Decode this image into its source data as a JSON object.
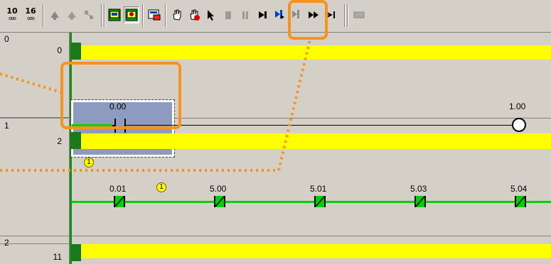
{
  "toolbar": {
    "btn_10": {
      "top": "10",
      "bottom": "ooo"
    },
    "btn_16": {
      "top": "16",
      "bottom": "ooo"
    },
    "icons": [
      "step-in-icon",
      "step-out-icon",
      "network-icon",
      "monitor-window-icon",
      "monitor-mode-icon",
      "program-check-icon",
      "hand-icon",
      "hand-stop-icon",
      "pointer-icon",
      "stop-icon",
      "pause-icon",
      "step-icon",
      "step-over-icon",
      "step-back-icon",
      "fast-forward-icon",
      "end-icon",
      "comment-icon"
    ]
  },
  "rungs": [
    {
      "number": "0",
      "step": "0"
    },
    {
      "number": "1",
      "step": "2"
    },
    {
      "number": "2",
      "step": "11"
    }
  ],
  "rung0": {
    "contact_addr": "0.00",
    "coil_addr": "1.00"
  },
  "rung1": {
    "badge_top": "1",
    "badge_mid": "1",
    "contacts": [
      "0.01",
      "5.00",
      "5.01",
      "5.03",
      "5.04"
    ]
  },
  "colors": {
    "highlight": "#f5931f",
    "power_flow": "#00d000",
    "rung_bar": "#ffff00",
    "selection": "#8d9bc0"
  }
}
